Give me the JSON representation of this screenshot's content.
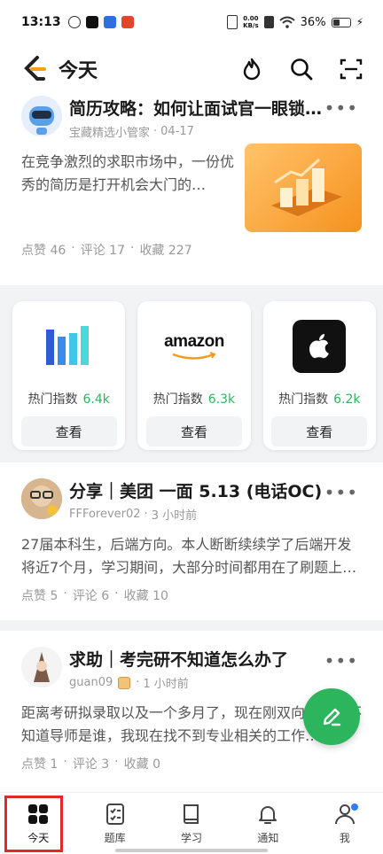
{
  "status_bar": {
    "time": "13:13",
    "net_speed_value": "0.00",
    "net_speed_unit": "KB/s",
    "battery": "36%"
  },
  "header": {
    "title": "今天",
    "icons": [
      "leetcode-logo-icon",
      "flame-icon",
      "search-icon",
      "scan-icon"
    ]
  },
  "posts": [
    {
      "title": "简历攻略：如何让面试官一眼锁…",
      "author": "宝藏精选小管家",
      "time": "04-17",
      "body": "在竞争激烈的求职市场中，一份优秀的简历是打开机会大门的…",
      "likes": "点赞 46",
      "comments": "评论 17",
      "favorites": "收藏 227"
    },
    {
      "title": "分享｜美团 一面 5.13 (电话OC)",
      "author": "FFForever02",
      "time": "3 小时前",
      "body": "27届本科生，后端方向。本人断断续续学了后端开发将近7个月，学习期间，大部分时间都用在了刷题上…",
      "likes": "点赞 5",
      "comments": "评论 6",
      "favorites": "收藏 10"
    },
    {
      "title": "求助｜考完研不知道怎么办了",
      "author": "guan09",
      "time": "1 小时前",
      "body": "距离考研拟录取以及一个多月了，现在刚双向选择，不知道导师是谁，我现在找不到专业相关的工作…",
      "likes": "点赞 1",
      "comments": "评论 3",
      "favorites": "收藏 0"
    }
  ],
  "companies": [
    {
      "name": "meituan",
      "hot_label": "热门指数",
      "hot_value": "6.4k",
      "button": "查看"
    },
    {
      "name": "amazon",
      "logo_text": "amazon",
      "hot_label": "热门指数",
      "hot_value": "6.3k",
      "button": "查看"
    },
    {
      "name": "apple",
      "hot_label": "热门指数",
      "hot_value": "6.2k",
      "button": "查看"
    }
  ],
  "bottom_nav": [
    {
      "label": "今天",
      "icon": "grid-icon",
      "active": true
    },
    {
      "label": "题库",
      "icon": "checklist-icon",
      "active": false
    },
    {
      "label": "学习",
      "icon": "book-icon",
      "active": false
    },
    {
      "label": "通知",
      "icon": "bell-icon",
      "active": false
    },
    {
      "label": "我",
      "icon": "user-icon",
      "active": false
    }
  ],
  "colors": {
    "accent": "#2db55d",
    "highlight": "#e02a2a",
    "badge": "#2f7df6"
  }
}
